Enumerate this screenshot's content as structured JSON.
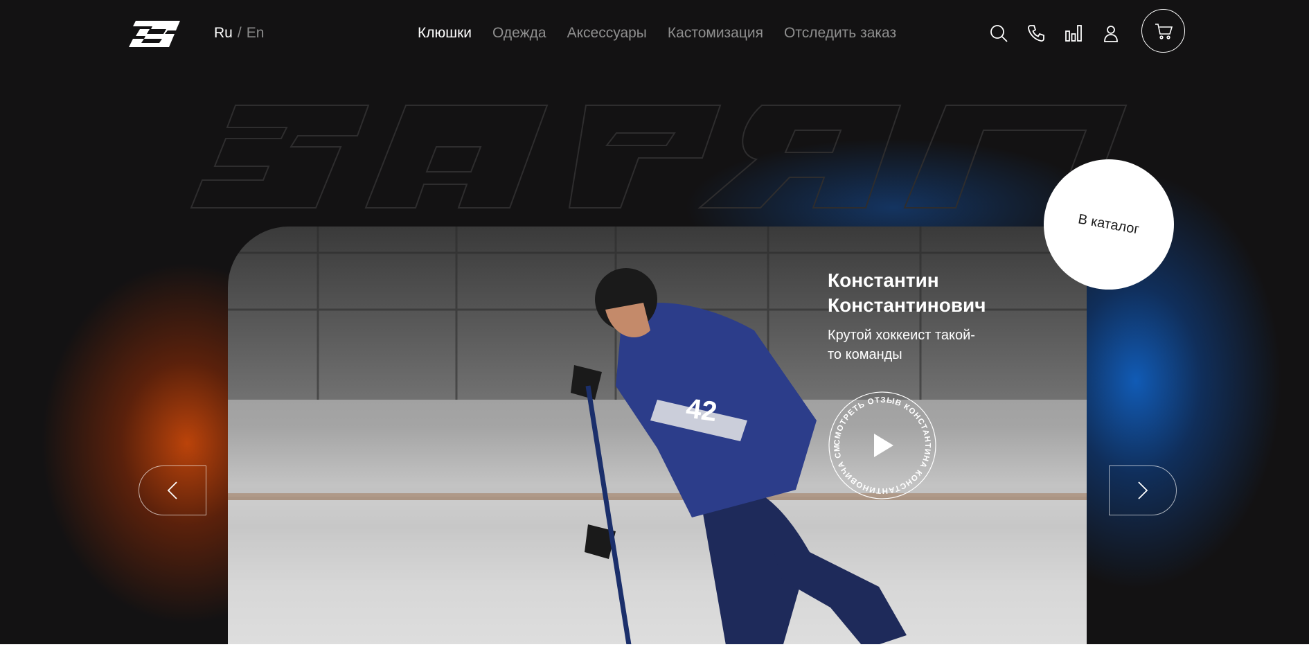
{
  "header": {
    "logo_icon": "brand-logo-icon",
    "lang": {
      "active": "Ru",
      "separator": "/",
      "other": "En"
    },
    "nav": [
      {
        "label": "Клюшки",
        "active": true
      },
      {
        "label": "Одежда",
        "active": false
      },
      {
        "label": "Аксессуары",
        "active": false
      },
      {
        "label": "Кастомизация",
        "active": false
      },
      {
        "label": "Отследить заказ",
        "active": false
      }
    ],
    "icons": [
      "search-icon",
      "phone-icon",
      "compare-icon",
      "user-icon",
      "cart-icon"
    ]
  },
  "hero": {
    "person_name": "Константин Константинович",
    "person_desc": "Крутой хоккеист такой-то команды",
    "review_ring_text": "СМОТРЕТЬ ОТЗЫВ КОНСТАНТИНА КОНСТАНТИНОВИЧА СМОТРЕТ",
    "catalog_label": "В каталог",
    "jersey_number": "42",
    "glow_left_color": "#c4460a",
    "glow_right_color": "#115fbe"
  }
}
